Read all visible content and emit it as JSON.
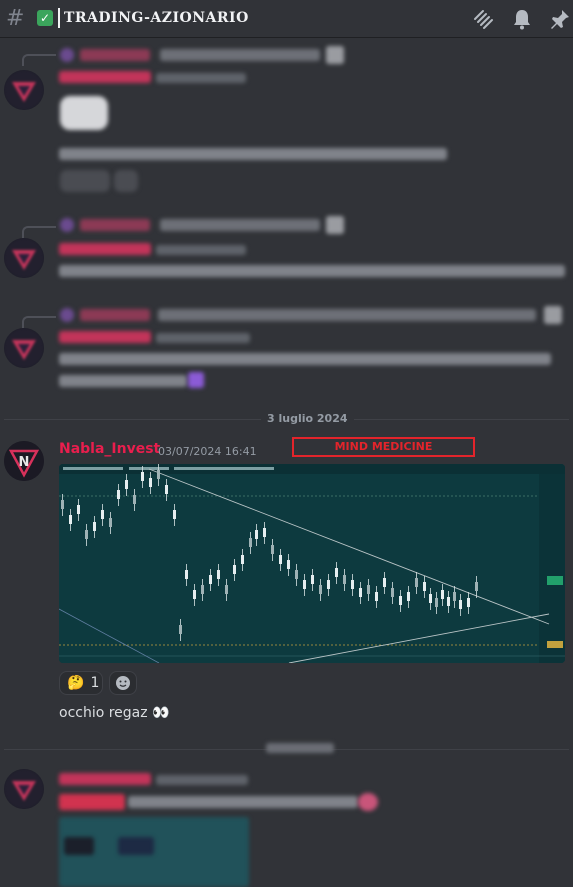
{
  "header": {
    "channel_name": "TRADING-AZIONARIO",
    "icons": [
      "hash-icon",
      "channel-emoji-icon",
      "threads-icon",
      "notification-bell-icon",
      "pin-icon"
    ]
  },
  "date_divider_1": "3 luglio 2024",
  "message": {
    "author": "Nabla_Invest",
    "timestamp": "03/07/2024 16:41",
    "annotation": "MIND MEDICINE",
    "reaction_count": "1",
    "text": "occhio regaz 👀"
  },
  "colors": {
    "background": "#313338",
    "author": "#e91e4d",
    "annotation": "#e3242b",
    "chart_bg": "#0d3a3f"
  }
}
